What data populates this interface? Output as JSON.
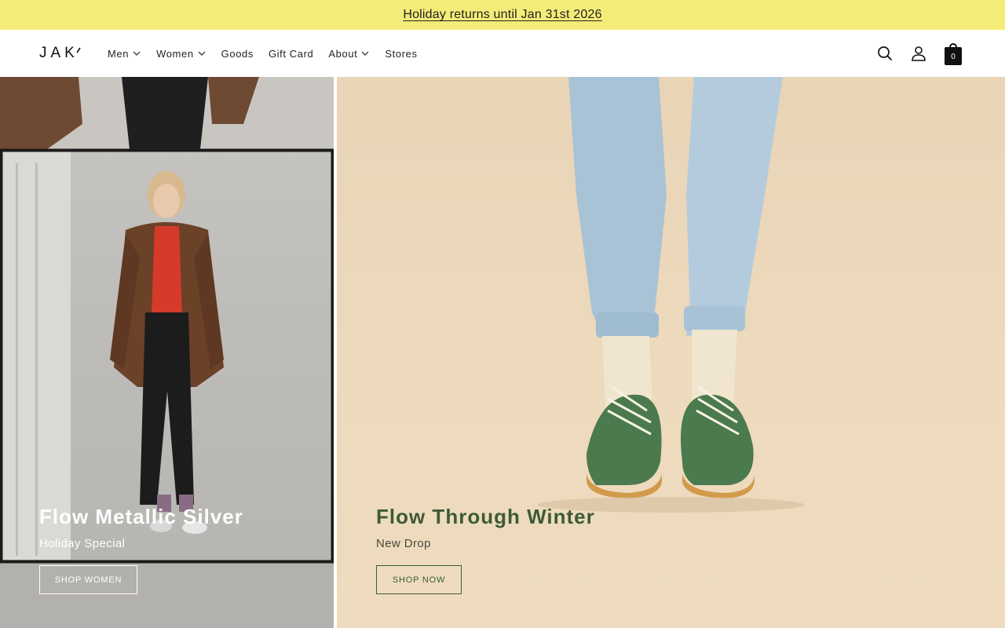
{
  "announcement": {
    "text": "Holiday returns until Jan 31st 2026"
  },
  "header": {
    "logo": "JAK",
    "nav": [
      {
        "label": "Men",
        "dropdown": true
      },
      {
        "label": "Women",
        "dropdown": true
      },
      {
        "label": "Goods",
        "dropdown": false
      },
      {
        "label": "Gift Card",
        "dropdown": false
      },
      {
        "label": "About",
        "dropdown": true
      },
      {
        "label": "Stores",
        "dropdown": false
      }
    ],
    "icons": {
      "search": "search-icon",
      "account": "user-icon",
      "cart": "bag-icon"
    },
    "cart_count": "0"
  },
  "hero": {
    "left": {
      "title": "Flow Metallic Silver",
      "subtitle": "Holiday Special",
      "cta": "SHOP WOMEN",
      "text_color": "#ffffff"
    },
    "right": {
      "title": "Flow Through Winter",
      "subtitle": "New Drop",
      "cta": "SHOP NOW",
      "text_color": "#3d5b36"
    }
  },
  "colors": {
    "announcement_bg": "#f4ec78",
    "accent_green": "#3d5b36",
    "right_bg": "#ecd7bb"
  }
}
